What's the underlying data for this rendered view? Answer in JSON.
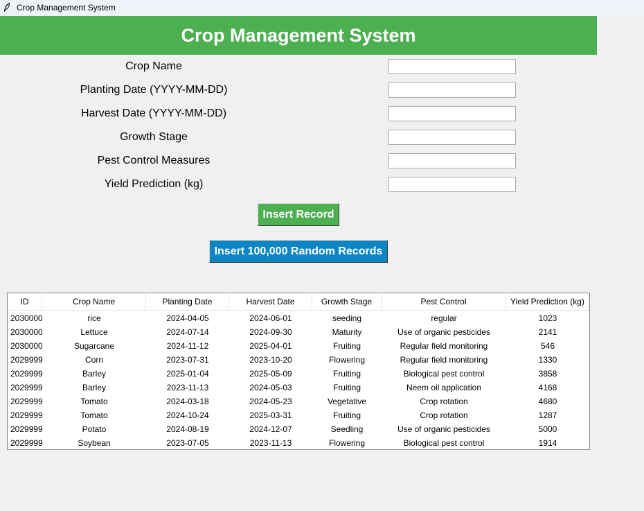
{
  "window": {
    "title": "Crop Management System",
    "icon": "feather-icon"
  },
  "header": {
    "title": "Crop Management System",
    "color": "#4caf50"
  },
  "form": {
    "fields": [
      {
        "label": "Crop Name",
        "value": ""
      },
      {
        "label": "Planting Date (YYYY-MM-DD)",
        "value": ""
      },
      {
        "label": "Harvest Date (YYYY-MM-DD)",
        "value": ""
      },
      {
        "label": "Growth Stage",
        "value": ""
      },
      {
        "label": "Pest Control Measures",
        "value": ""
      },
      {
        "label": "Yield Prediction (kg)",
        "value": ""
      }
    ]
  },
  "buttons": {
    "insert_label": "Insert Record",
    "insert_color": "#4caf50",
    "random_label": "Insert 100,000 Random Records",
    "random_color": "#0b86c2"
  },
  "table": {
    "columns": [
      "ID",
      "Crop Name",
      "Planting Date",
      "Harvest Date",
      "Growth Stage",
      "Pest Control",
      "Yield Prediction (kg)"
    ],
    "rows": [
      [
        "2030000",
        "rice",
        "2024-04-05",
        "2024-06-01",
        "seeding",
        "regular",
        "1023"
      ],
      [
        "2030000",
        "Lettuce",
        "2024-07-14",
        "2024-09-30",
        "Maturity",
        "Use of organic pesticides",
        "2141"
      ],
      [
        "2030000",
        "Sugarcane",
        "2024-11-12",
        "2025-04-01",
        "Fruiting",
        "Regular field monitoring",
        "546"
      ],
      [
        "2029999",
        "Corn",
        "2023-07-31",
        "2023-10-20",
        "Flowering",
        "Regular field monitoring",
        "1330"
      ],
      [
        "2029999",
        "Barley",
        "2025-01-04",
        "2025-05-09",
        "Fruiting",
        "Biological pest control",
        "3858"
      ],
      [
        "2029999",
        "Barley",
        "2023-11-13",
        "2024-05-03",
        "Fruiting",
        "Neem oil application",
        "4168"
      ],
      [
        "2029999",
        "Tomato",
        "2024-03-18",
        "2024-05-23",
        "Vegetative",
        "Crop rotation",
        "4680"
      ],
      [
        "2029999",
        "Tomato",
        "2024-10-24",
        "2025-03-31",
        "Fruiting",
        "Crop rotation",
        "1287"
      ],
      [
        "2029999",
        "Potato",
        "2024-08-19",
        "2024-12-07",
        "Seedling",
        "Use of organic pesticides",
        "5000"
      ],
      [
        "2029999",
        "Soybean",
        "2023-07-05",
        "2023-11-13",
        "Flowering",
        "Biological pest control",
        "1914"
      ]
    ]
  }
}
